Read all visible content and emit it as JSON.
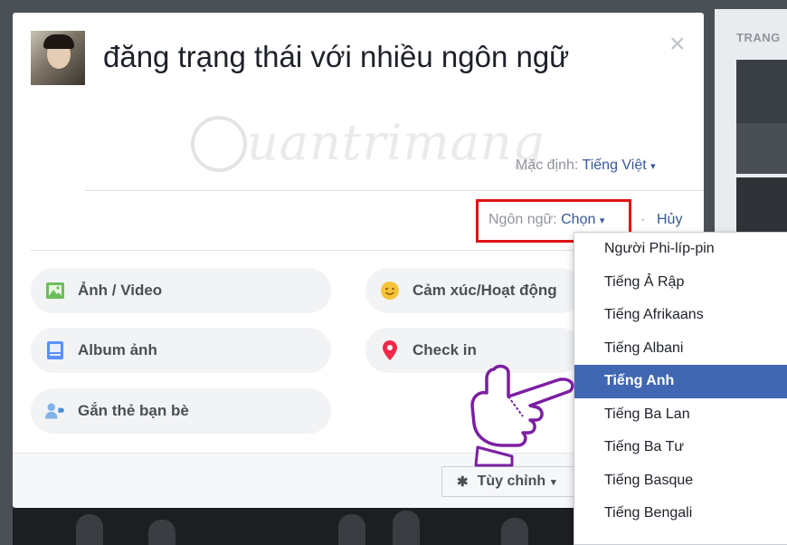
{
  "background": {
    "right_column_label": "TRANG"
  },
  "dialog": {
    "status_text": "đăng trạng thái với nhiều ngôn ngữ",
    "close_label": "×",
    "watermark_text": "uantrimang",
    "default_label": "Mặc định:",
    "default_value": "Tiếng Việt",
    "default_caret": "▾",
    "language_label": "Ngôn ngữ:",
    "language_value": "Chọn",
    "language_caret": "▾",
    "separator": "·",
    "cancel_label": "Hủy"
  },
  "options": [
    {
      "label": "Ảnh / Video",
      "icon": "photo-icon"
    },
    {
      "label": "Cảm xúc/Hoạt động",
      "icon": "smiley-icon"
    },
    {
      "label": "Album ảnh",
      "icon": "album-icon"
    },
    {
      "label": "Check in",
      "icon": "location-pin-icon"
    },
    {
      "label": "Gắn thẻ bạn bè",
      "icon": "tag-friends-icon"
    }
  ],
  "footer": {
    "customize_label": "Tùy chỉnh",
    "customize_icon": "gear-icon"
  },
  "dropdown": {
    "items": [
      "Người Phi-líp-pin",
      "Tiếng Ả Rập",
      "Tiếng Afrikaans",
      "Tiếng Albani",
      "Tiếng Anh",
      "Tiếng Ba Lan",
      "Tiếng Ba Tư",
      "Tiếng Basque",
      "Tiếng Bengali"
    ],
    "selected": "Tiếng Anh"
  },
  "colors": {
    "link": "#365899",
    "selected_bg": "#4267b2",
    "highlight_box": "#e01414"
  }
}
